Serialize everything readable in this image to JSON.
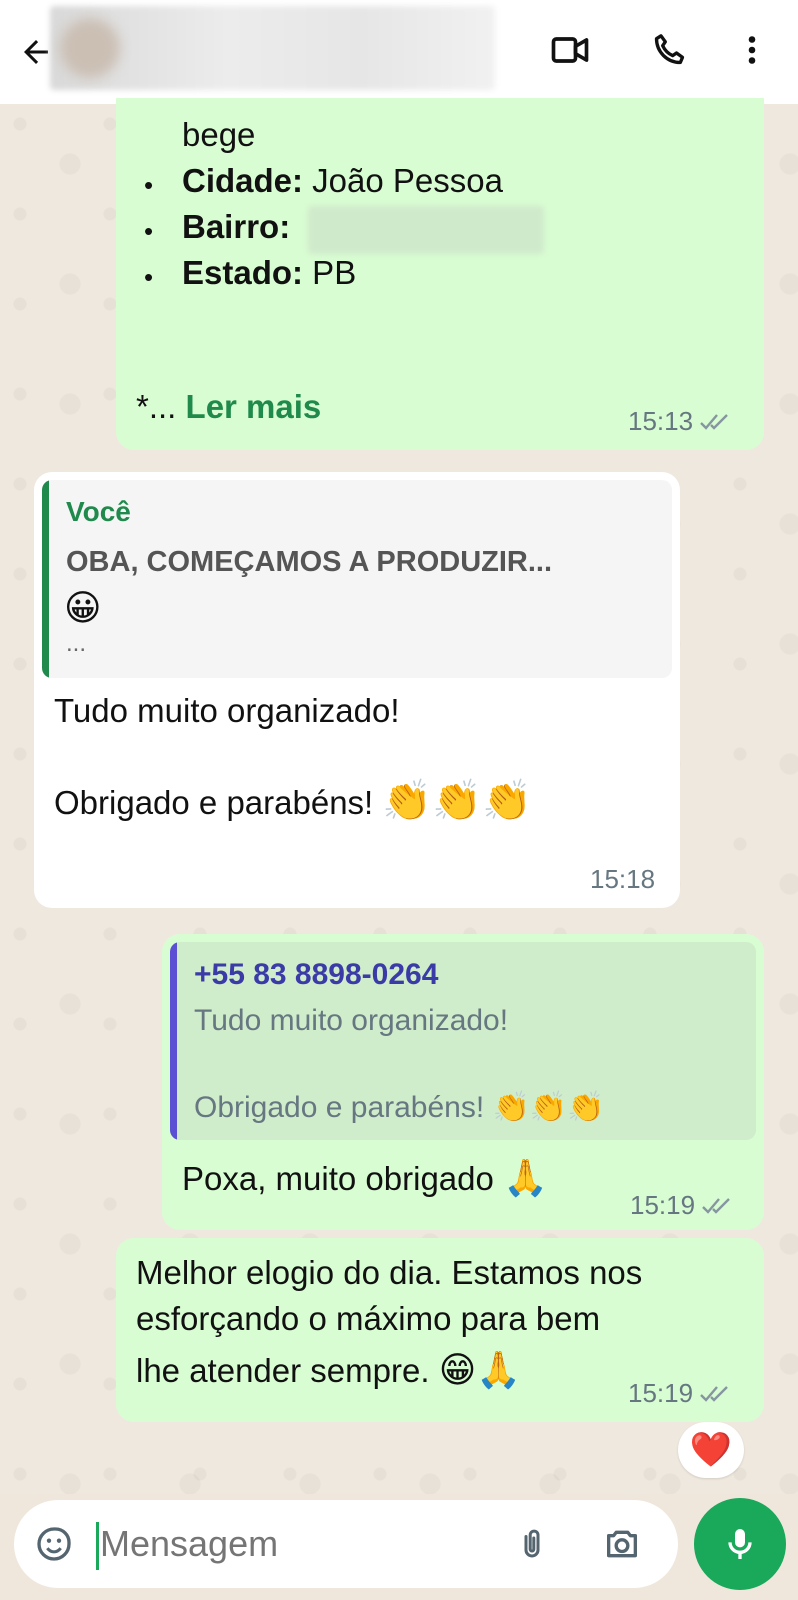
{
  "header": {
    "back_icon": "arrow-left-icon",
    "video_icon": "video-camera-icon",
    "call_icon": "phone-icon",
    "menu_icon": "more-vert-icon"
  },
  "msg1": {
    "partial_line": "bege",
    "items": [
      {
        "label": "Cidade:",
        "value": " João Pessoa"
      },
      {
        "label": "Bairro:",
        "value": ""
      },
      {
        "label": "Estado:",
        "value": " PB"
      }
    ],
    "ellipsis": "*...",
    "read_more": "Ler mais",
    "time": "15:13"
  },
  "msg2": {
    "quote_author": "Você",
    "quote_text": "OBA, COMEÇAMOS A PRODUZIR...",
    "quote_emoji": "😀",
    "quote_more": "...",
    "line1": "Tudo muito organizado!",
    "line2": "Obrigado e parabéns!",
    "line2_emoji": "👏👏👏",
    "time": "15:18"
  },
  "msg3": {
    "quote_author": "+55 83 8898-0264",
    "quote_line1": "Tudo muito organizado!",
    "quote_line2": "Obrigado e parabéns!",
    "quote_emoji": "👏👏👏",
    "text": "Poxa, muito obrigado",
    "emoji": "🙏",
    "time": "15:19"
  },
  "msg4": {
    "line1": "Melhor elogio do dia. Estamos nos",
    "line2": "esforçando o máximo para bem",
    "line3": "lhe atender sempre.",
    "emoji": "😁🙏",
    "time": "15:19",
    "reaction": "❤️"
  },
  "composer": {
    "placeholder": "Mensagem",
    "sticker_icon": "sticker-icon",
    "attach_icon": "paperclip-icon",
    "camera_icon": "camera-icon",
    "mic_icon": "microphone-icon"
  },
  "colors": {
    "outgoing": "#d9fdd3",
    "incoming": "#ffffff",
    "accent_green": "#1aa85a",
    "quote_you": "#1f8a4c",
    "quote_contact": "#5b4fd4"
  }
}
